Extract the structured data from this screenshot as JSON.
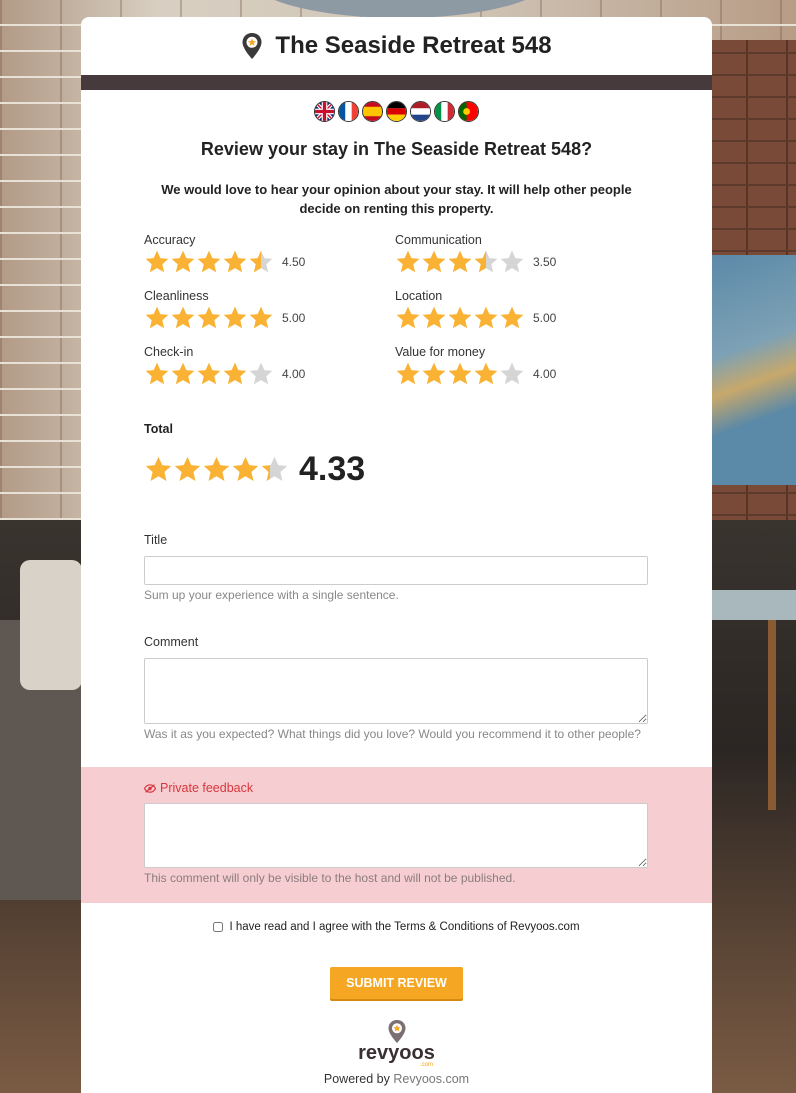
{
  "header": {
    "title": "The Seaside Retreat 548"
  },
  "languages": [
    {
      "code": "en",
      "icon": "uk-flag-icon"
    },
    {
      "code": "fr",
      "icon": "france-flag-icon"
    },
    {
      "code": "es",
      "icon": "spain-flag-icon"
    },
    {
      "code": "de",
      "icon": "germany-flag-icon"
    },
    {
      "code": "nl",
      "icon": "netherlands-flag-icon"
    },
    {
      "code": "it",
      "icon": "italy-flag-icon"
    },
    {
      "code": "pt",
      "icon": "portugal-flag-icon"
    }
  ],
  "review": {
    "heading": "Review your stay in The Seaside Retreat 548?",
    "intro": "We would love to hear your opinion about your stay. It will help other people decide on renting this property."
  },
  "ratings": [
    {
      "label": "Accuracy",
      "value": "4.50",
      "score": 4.5
    },
    {
      "label": "Communication",
      "value": "3.50",
      "score": 3.5
    },
    {
      "label": "Cleanliness",
      "value": "5.00",
      "score": 5
    },
    {
      "label": "Location",
      "value": "5.00",
      "score": 5
    },
    {
      "label": "Check-in",
      "value": "4.00",
      "score": 4
    },
    {
      "label": "Value for money",
      "value": "4.00",
      "score": 4
    }
  ],
  "total": {
    "label": "Total",
    "value": "4.33",
    "score": 4.33
  },
  "form": {
    "title_label": "Title",
    "title_value": "",
    "title_help": "Sum up your experience with a single sentence.",
    "comment_label": "Comment",
    "comment_value": "",
    "comment_help": "Was it as you expected? What things did you love? Would you recommend it to other people?",
    "private_label": "Private feedback",
    "private_value": "",
    "private_help": "This comment will only be visible to the host and will not be published.",
    "terms_text": "I have read and I agree with the Terms & Conditions of Revyoos.com",
    "terms_checked": false,
    "submit_label": "SUBMIT REVIEW"
  },
  "footer": {
    "brand_name": "revyoos",
    "brand_suffix": ".com",
    "powered_prefix": "Powered by",
    "powered_link": "Revyoos.com"
  },
  "colors": {
    "star": "#f9b233",
    "star_empty": "#d5d5d5",
    "accent": "#f5a623",
    "dark_bar": "#463a3d",
    "private_bg": "#f6ced1",
    "private_text": "#d9363e"
  }
}
